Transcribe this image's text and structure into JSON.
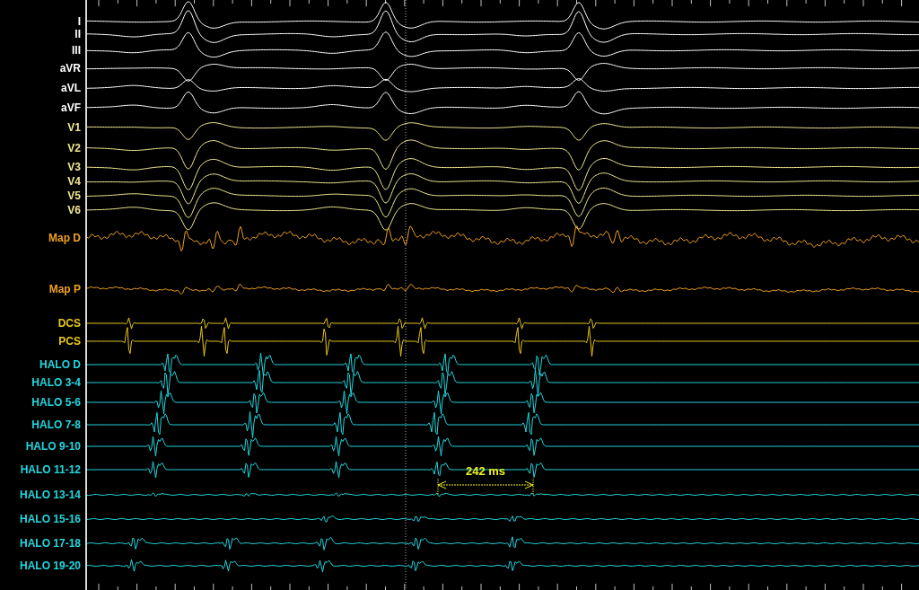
{
  "channels": [
    {
      "label": "I",
      "kind": "surface",
      "color": "#ffffff"
    },
    {
      "label": "II",
      "kind": "surface",
      "color": "#ffffff"
    },
    {
      "label": "III",
      "kind": "surface",
      "color": "#ffffff"
    },
    {
      "label": "aVR",
      "kind": "surface",
      "color": "#ffffff"
    },
    {
      "label": "aVL",
      "kind": "surface",
      "color": "#ffffff"
    },
    {
      "label": "aVF",
      "kind": "surface",
      "color": "#ffffff"
    },
    {
      "label": "V1",
      "kind": "surface",
      "color": "#f0e890"
    },
    {
      "label": "V2",
      "kind": "surface",
      "color": "#f0e890"
    },
    {
      "label": "V3",
      "kind": "surface",
      "color": "#f0e890"
    },
    {
      "label": "V4",
      "kind": "surface",
      "color": "#f0e890"
    },
    {
      "label": "V5",
      "kind": "surface",
      "color": "#f0e890"
    },
    {
      "label": "V6",
      "kind": "surface",
      "color": "#f0e890"
    },
    {
      "label": "Map D",
      "kind": "map",
      "color": "#f0a020"
    },
    {
      "label": "Map P",
      "kind": "map",
      "color": "#f0a020"
    },
    {
      "label": "DCS",
      "kind": "cs",
      "color": "#e8c818"
    },
    {
      "label": "PCS",
      "kind": "cs",
      "color": "#e8c818"
    },
    {
      "label": "HALO D",
      "kind": "halo",
      "color": "#20d8e0"
    },
    {
      "label": "HALO 3-4",
      "kind": "halo",
      "color": "#20d8e0"
    },
    {
      "label": "HALO 5-6",
      "kind": "halo",
      "color": "#20d8e0"
    },
    {
      "label": "HALO 7-8",
      "kind": "halo",
      "color": "#20d8e0"
    },
    {
      "label": "HALO 9-10",
      "kind": "halo",
      "color": "#20d8e0"
    },
    {
      "label": "HALO 11-12",
      "kind": "halo",
      "color": "#20d8e0"
    },
    {
      "label": "HALO 13-14",
      "kind": "halo",
      "color": "#20d8e0"
    },
    {
      "label": "HALO 15-16",
      "kind": "halo",
      "color": "#20d8e0"
    },
    {
      "label": "HALO 17-18",
      "kind": "halo",
      "color": "#20d8e0"
    },
    {
      "label": "HALO 19-20",
      "kind": "halo",
      "color": "#20d8e0"
    }
  ],
  "caliper": {
    "label": "242 ms"
  }
}
